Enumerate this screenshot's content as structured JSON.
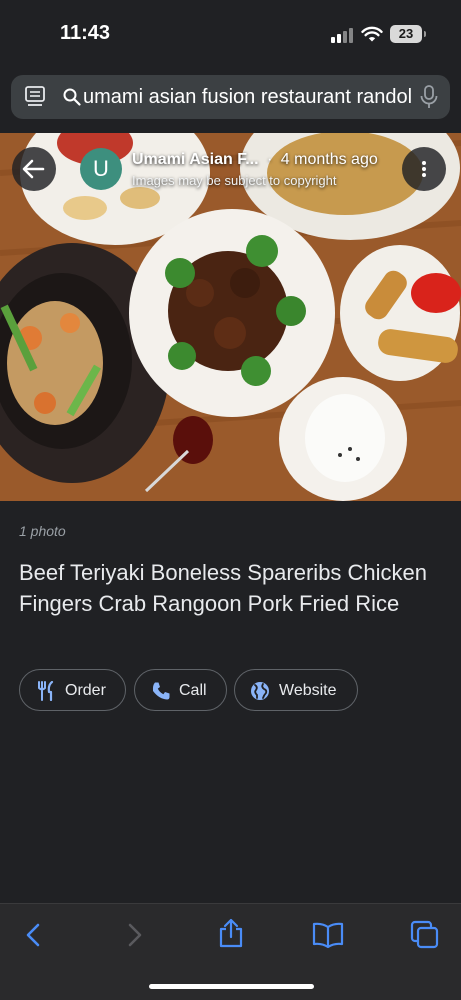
{
  "status_bar": {
    "time": "11:43",
    "battery": "23"
  },
  "search": {
    "query": "umami asian fusion restaurant randol"
  },
  "image_header": {
    "avatar_letter": "U",
    "source_name": "Umami Asian F...",
    "separator": "·",
    "age": "4 months ago",
    "copyright_note": "Images may be subject to copyright"
  },
  "details": {
    "photo_count": "1 photo",
    "description": "Beef Teriyaki Boneless Spareribs Chicken Fingers Crab Rangoon Pork Fried Rice"
  },
  "actions": {
    "order_label": "Order",
    "call_label": "Call",
    "website_label": "Website"
  },
  "icons": {
    "tabs": "tabs-icon",
    "search": "search-icon",
    "mic": "mic-icon",
    "back": "back-arrow-icon",
    "more": "more-vert-icon",
    "order": "fork-knife-icon",
    "call": "phone-icon",
    "website": "globe-icon",
    "nav_back": "chevron-left-icon",
    "nav_forward": "chevron-right-icon",
    "share": "share-icon",
    "bookmarks": "book-icon",
    "tabs_overview": "tabs-overview-icon"
  },
  "colors": {
    "accent": "#8ab4f8",
    "toolbar_blue": "#4a8cf7",
    "avatar": "#3d8f7e"
  }
}
